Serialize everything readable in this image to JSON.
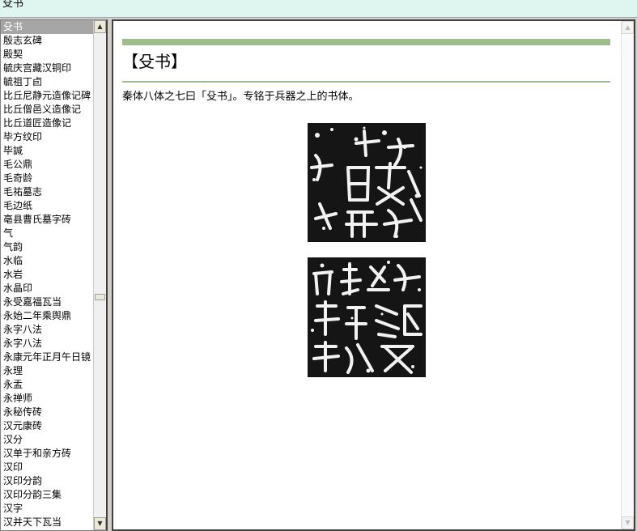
{
  "window": {
    "title": "殳书"
  },
  "sidebar": {
    "selected_index": 0,
    "items": [
      "殳书",
      "殷志玄碑",
      "殿契",
      "毓庆宫藏汉铜印",
      "毓祖丁卣",
      "比丘尼静元造像记碑",
      "比丘僧邑义造像记",
      "比丘道匠造像记",
      "毕方纹印",
      "毕諴",
      "毛公鼎",
      "毛奇龄",
      "毛祐墓志",
      "毛边纸",
      "亳县曹氏墓字砖",
      "气",
      "气韵",
      "水临",
      "水岩",
      "水晶印",
      "永受嘉福瓦当",
      "永始二年乘舆鼎",
      "永字八法",
      "永字八法",
      "永康元年正月午日镜",
      "永理",
      "永盂",
      "永禅师",
      "永秘传砖",
      "汉元康砖",
      "汉分",
      "汉单于和亲方砖",
      "汉印",
      "汉印分韵",
      "汉印分韵三集",
      "汉字",
      "汉并天下瓦当"
    ]
  },
  "article": {
    "title": "【殳书】",
    "description": "秦体八体之七曰「殳书」。专铭于兵器之上的书体。"
  },
  "colors": {
    "accent_green": "#9fbd8c",
    "selection": "#a6a6a6"
  },
  "icons": {
    "scroll_up": "triangle-up",
    "scroll_down": "triangle-down"
  }
}
